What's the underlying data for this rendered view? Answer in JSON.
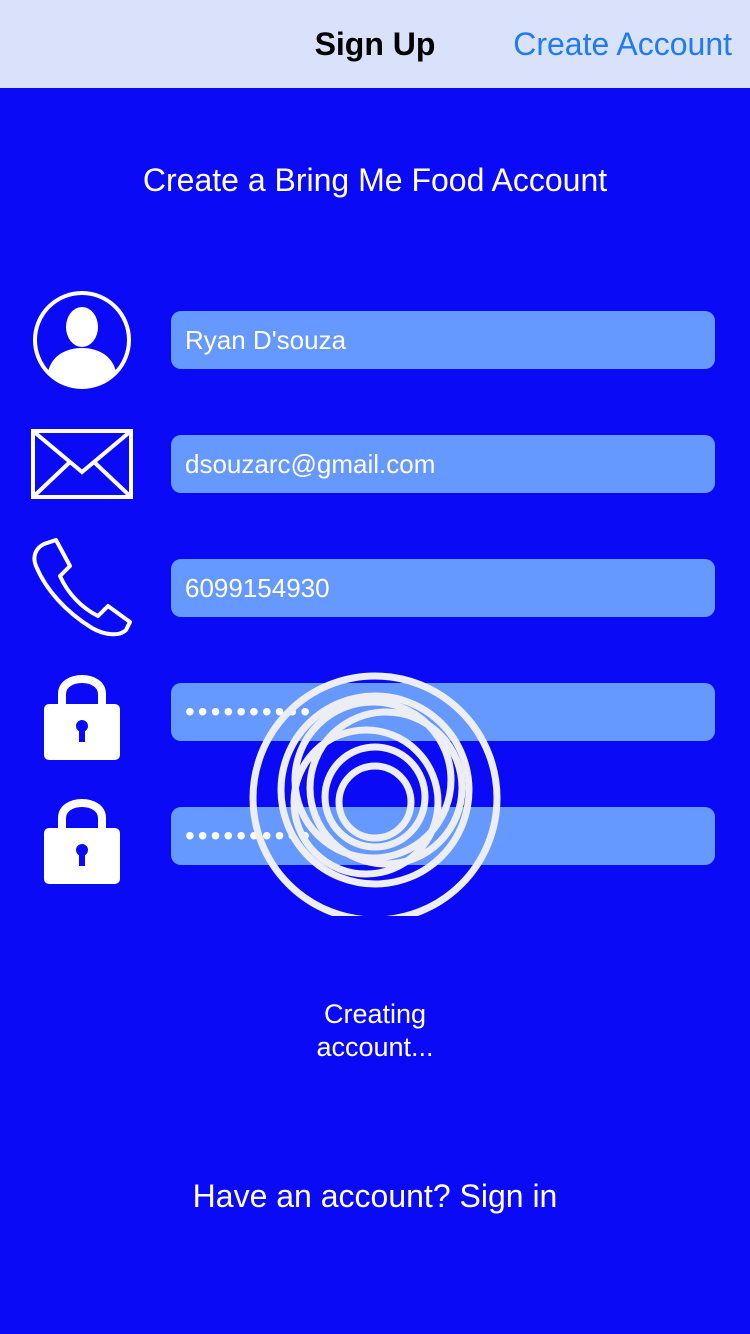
{
  "navbar": {
    "title": "Sign Up",
    "action_label": "Create Account"
  },
  "heading": "Create a Bring Me Food Account",
  "fields": {
    "name": {
      "icon": "user-avatar-icon",
      "value": "Ryan D'souza"
    },
    "email": {
      "icon": "envelope-icon",
      "value": "dsouzarc@gmail.com"
    },
    "phone": {
      "icon": "phone-icon",
      "value": "6099154930"
    },
    "password": {
      "icon": "lock-icon",
      "value": "••••••••••"
    },
    "confirm_password": {
      "icon": "lock-icon",
      "value": "••••••••••"
    }
  },
  "loading": {
    "icon": "loading-spinner-icon",
    "line1": "Creating",
    "line2": "account..."
  },
  "signin_link": "Have an account? Sign in",
  "colors": {
    "background": "#0A0AF7",
    "navbar": "#D9E1FB",
    "field": "#6699FF",
    "accent": "#1E7CF0"
  }
}
